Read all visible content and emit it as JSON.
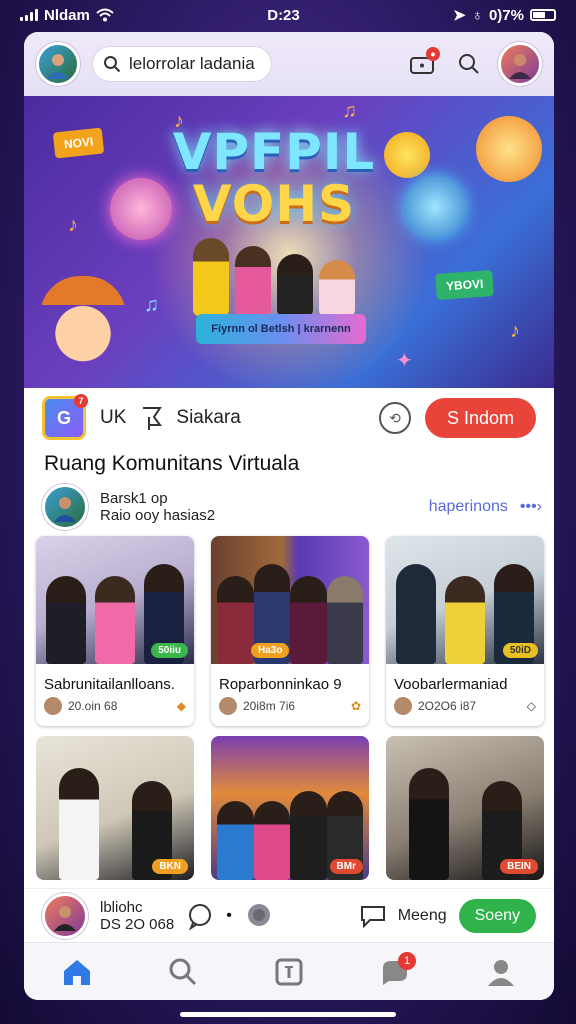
{
  "status_bar": {
    "carrier": "Nldam",
    "time": "D:23",
    "battery": "0)7%"
  },
  "top_bar": {
    "search_text": "lelorrolar ladania"
  },
  "banner": {
    "title_line1": "VPFPIL",
    "title_line2": "VOHS",
    "ribbon_text": "Fiyrnn ol Betlsh | krarnenn",
    "tag_left": "NOVI",
    "tag_right": "YBOVI"
  },
  "action_row": {
    "label_1": "UK",
    "label_2": "Siakara",
    "primary_button": "S Indom",
    "app_badge": "7"
  },
  "section_title": "Ruang Komunitans Virtuala",
  "creator": {
    "name_line1": "Barsk1 op",
    "name_line2": "Raio ooy hasias2",
    "link": "haperinons",
    "more": "•••›"
  },
  "cards": [
    {
      "title": "Sabrunitailanlloans.",
      "meta": "20.oin 68",
      "badge": "50iiu",
      "icon": "◆"
    },
    {
      "title": "Roparbonninkao 9",
      "meta": "20i8m 7i6",
      "badge": "Ha3o",
      "icon": "✿"
    },
    {
      "title": "Voobarlermaniad",
      "meta": "2O2O6 i87",
      "badge": "50iD",
      "icon": "◇"
    },
    {
      "title": "",
      "meta": "",
      "badge": "BKN",
      "icon": ""
    },
    {
      "title": "",
      "meta": "",
      "badge": "BMr",
      "icon": ""
    },
    {
      "title": "",
      "meta": "",
      "badge": "BEIN",
      "icon": ""
    }
  ],
  "footer_row": {
    "user_line1": "lbliohc",
    "user_line2": "DS 2O 068",
    "label": "Meeng",
    "button": "Soeny"
  },
  "tab_bar": {
    "messages_badge": "1"
  },
  "colors": {
    "primary_red": "#e8443a",
    "green": "#2fb34a",
    "link_blue": "#5c6ad8",
    "tab_active": "#2f7ae5"
  }
}
